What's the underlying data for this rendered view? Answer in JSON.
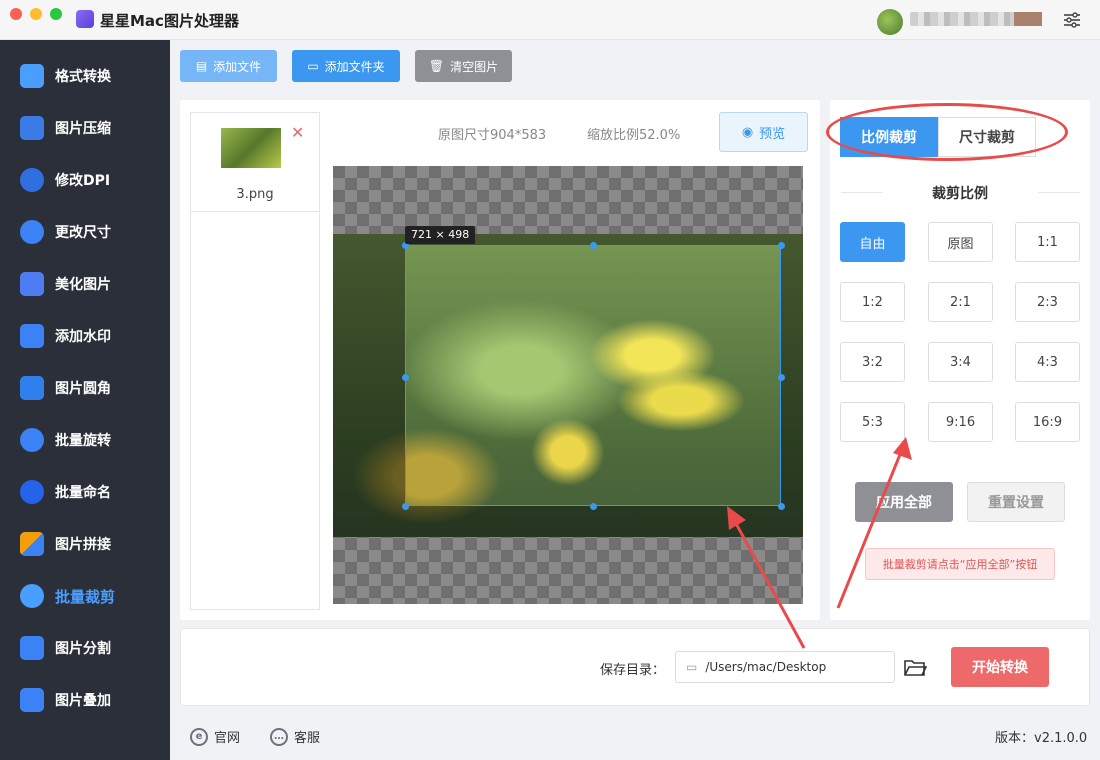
{
  "app": {
    "title": "星星Mac图片处理器"
  },
  "sidebar": {
    "items": [
      {
        "label": "格式转换",
        "icon": "format-convert-icon",
        "color": "#4a9eff"
      },
      {
        "label": "图片压缩",
        "icon": "compress-icon",
        "color": "#3b7be8"
      },
      {
        "label": "修改DPI",
        "icon": "dpi-icon",
        "color": "#2f6fe0"
      },
      {
        "label": "更改尺寸",
        "icon": "resize-icon",
        "color": "#3b82f6"
      },
      {
        "label": "美化图片",
        "icon": "beautify-icon",
        "color": "#4d7cf3"
      },
      {
        "label": "添加水印",
        "icon": "watermark-icon",
        "color": "#3b82f6"
      },
      {
        "label": "图片圆角",
        "icon": "round-corner-icon",
        "color": "#2f80ed"
      },
      {
        "label": "批量旋转",
        "icon": "rotate-icon",
        "color": "#3b82f6"
      },
      {
        "label": "批量命名",
        "icon": "rename-icon",
        "color": "#2563eb"
      },
      {
        "label": "图片拼接",
        "icon": "stitch-icon",
        "color": "#f59e0b"
      },
      {
        "label": "批量裁剪",
        "icon": "crop-icon",
        "color": "#4a9eff",
        "active": true
      },
      {
        "label": "图片分割",
        "icon": "split-icon",
        "color": "#3b82f6"
      },
      {
        "label": "图片叠加",
        "icon": "overlay-icon",
        "color": "#3b82f6"
      }
    ]
  },
  "toolbar": {
    "add_file": "添加文件",
    "add_folder": "添加文件夹",
    "clear": "清空图片"
  },
  "files": [
    {
      "name": "3.png"
    }
  ],
  "image_info": {
    "original_size": "原图尺寸904*583",
    "zoom": "缩放比例52.0%"
  },
  "preview_label": "预览",
  "crop_size_tag": "721 × 498",
  "tabs": {
    "ratio": "比例裁剪",
    "size": "尺寸裁剪"
  },
  "section_title": "裁剪比例",
  "ratios": [
    "自由",
    "原图",
    "1:1",
    "1:2",
    "2:1",
    "2:3",
    "3:2",
    "3:4",
    "4:3",
    "5:3",
    "9:16",
    "16:9"
  ],
  "selected_ratio": "自由",
  "apply_all": "应用全部",
  "reset": "重置设置",
  "hint": "批量裁剪请点击“应用全部”按钮",
  "save": {
    "label": "保存目录：",
    "path": "/Users/mac/Desktop"
  },
  "start": "开始转换",
  "footer": {
    "website": "官网",
    "service": "客服",
    "version": "版本：v2.1.0.0"
  },
  "colors": {
    "accent": "#3b97f0",
    "danger": "#ee6a6a",
    "sidebar_bg": "#2b2f3a",
    "annotation": "#e94a4a"
  }
}
